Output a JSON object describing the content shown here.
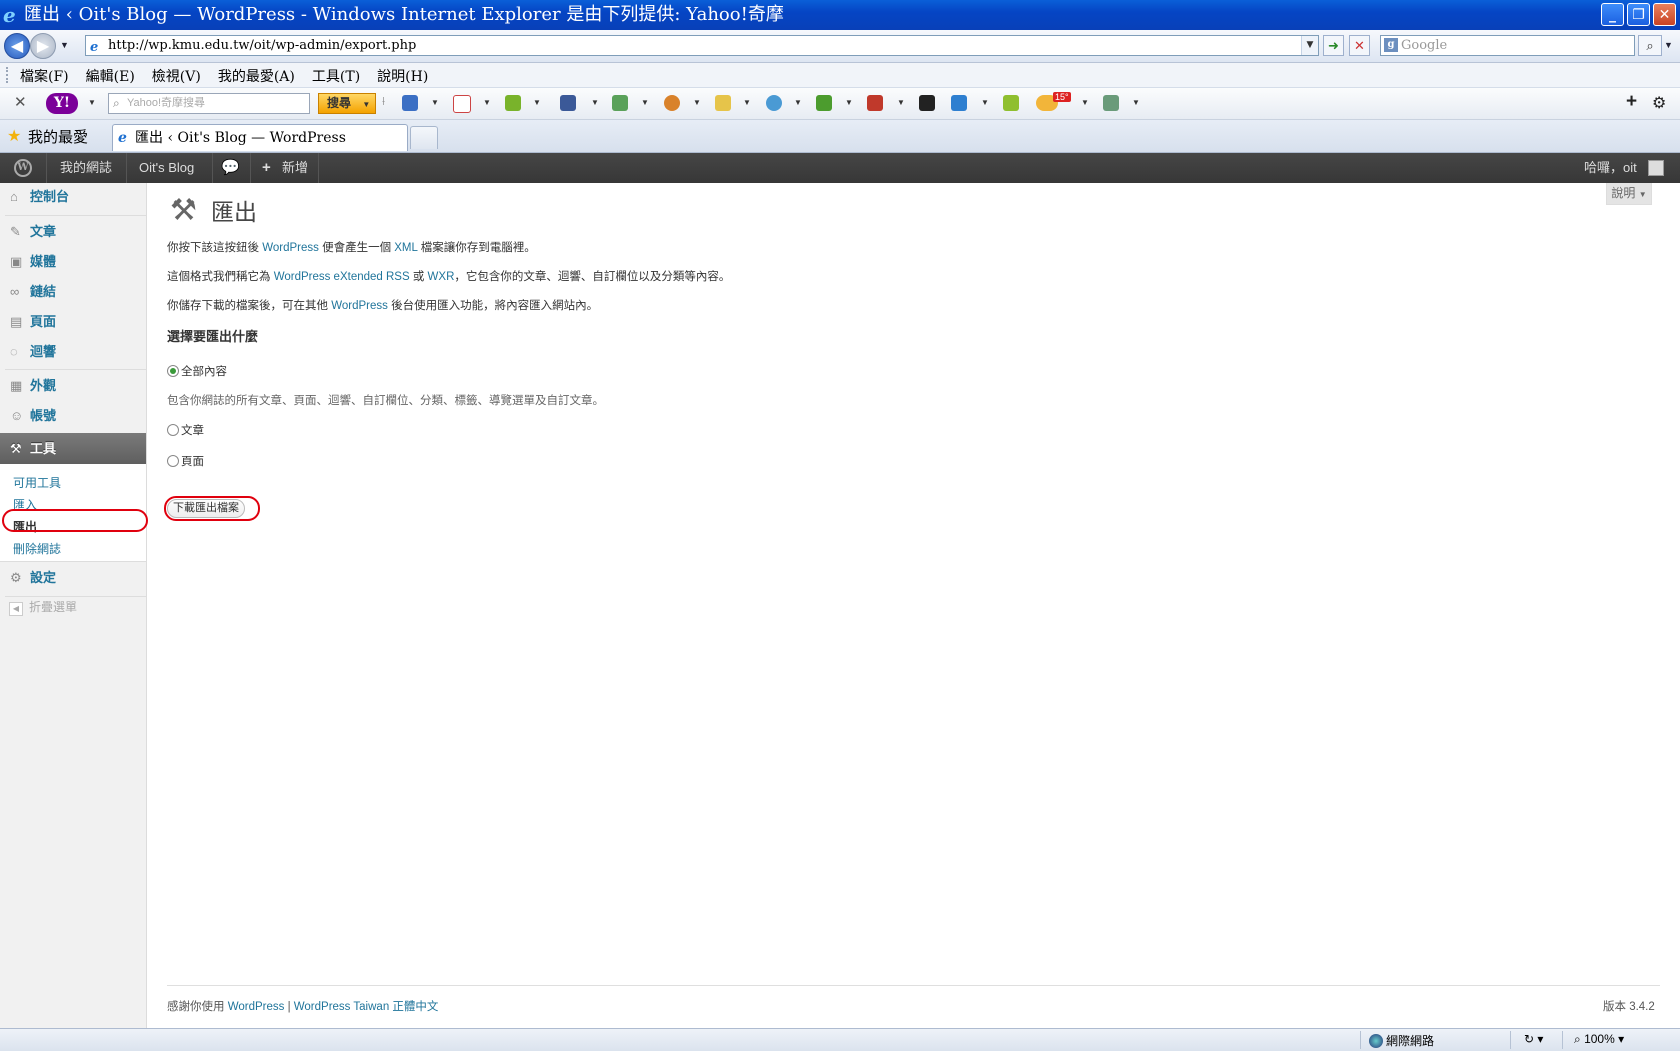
{
  "window": {
    "title": "匯出 ‹ Oit's Blog — WordPress - Windows Internet Explorer 是由下列提供: Yahoo!奇摩",
    "controls": [
      "_",
      "❐",
      "✕"
    ]
  },
  "address": {
    "url": "http://wp.kmu.edu.tw/oit/wp-admin/export.php",
    "search_placeholder": "Google"
  },
  "menubar": [
    "檔案(F)",
    "編輯(E)",
    "檢視(V)",
    "我的最愛(A)",
    "工具(T)",
    "說明(H)"
  ],
  "yahoo_toolbar": {
    "logo": "Y!",
    "search_placeholder": "Yahoo!奇摩搜尋",
    "search_button": "搜尋",
    "weather_badge": "15°"
  },
  "tabs": {
    "favorites_label": "我的最愛",
    "active_tab": "匯出 ‹ Oit's Blog — WordPress"
  },
  "wp_adminbar": {
    "my_sites": "我的網誌",
    "site_name": "Oit's Blog",
    "new": "新增",
    "greeting": "哈囉，oit"
  },
  "sidebar": {
    "items": [
      {
        "label": "控制台",
        "icon": "dashboard-icon"
      },
      {
        "label": "文章",
        "icon": "pin-icon"
      },
      {
        "label": "媒體",
        "icon": "media-icon"
      },
      {
        "label": "鏈結",
        "icon": "link-icon"
      },
      {
        "label": "頁面",
        "icon": "page-icon"
      },
      {
        "label": "迴響",
        "icon": "comment-icon"
      },
      {
        "label": "外觀",
        "icon": "appearance-icon"
      },
      {
        "label": "帳號",
        "icon": "users-icon"
      },
      {
        "label": "工具",
        "icon": "tools-icon"
      },
      {
        "label": "設定",
        "icon": "settings-icon"
      }
    ],
    "tools_submenu": [
      "可用工具",
      "匯入",
      "匯出",
      "刪除網誌"
    ],
    "collapse": "折疊選單"
  },
  "main": {
    "help_tab": "說明",
    "page_title": "匯出",
    "p1": {
      "a": "你按下該這按鈕後 ",
      "b": "WordPress",
      "c": " 便會產生一個 ",
      "d": "XML",
      "e": " 檔案讓你存到電腦裡。"
    },
    "p2": {
      "a": "這個格式我們稱它為 ",
      "b": "WordPress eXtended RSS",
      "c": " 或 ",
      "d": "WXR",
      "e": "，它包含你的文章、迴響、自訂欄位以及分類等內容。"
    },
    "p3": {
      "a": "你儲存下載的檔案後，可在其他 ",
      "b": "WordPress",
      "c": " 後台使用匯入功能，將內容匯入網站內。"
    },
    "section_heading": "選擇要匯出什麼",
    "options": [
      {
        "label": "全部內容",
        "checked": true
      },
      {
        "label": "文章",
        "checked": false
      },
      {
        "label": "頁面",
        "checked": false
      }
    ],
    "all_description": "包含你網誌的所有文章、頁面、迴響、自訂欄位、分類、標籤、導覽選單及自訂文章。",
    "download_button": "下載匯出檔案"
  },
  "footer": {
    "thanks": "感謝你使用 ",
    "wp_link": "WordPress",
    "sep": " | ",
    "tw_link": "WordPress Taiwan 正體中文",
    "version": "版本 3.4.2"
  },
  "statusbar": {
    "zone": "網際網路",
    "zoom": "100%"
  },
  "colors": {
    "wp_link": "#21759b",
    "annotation_red": "#e0000e",
    "ie_titlebar": "#0545c4"
  }
}
